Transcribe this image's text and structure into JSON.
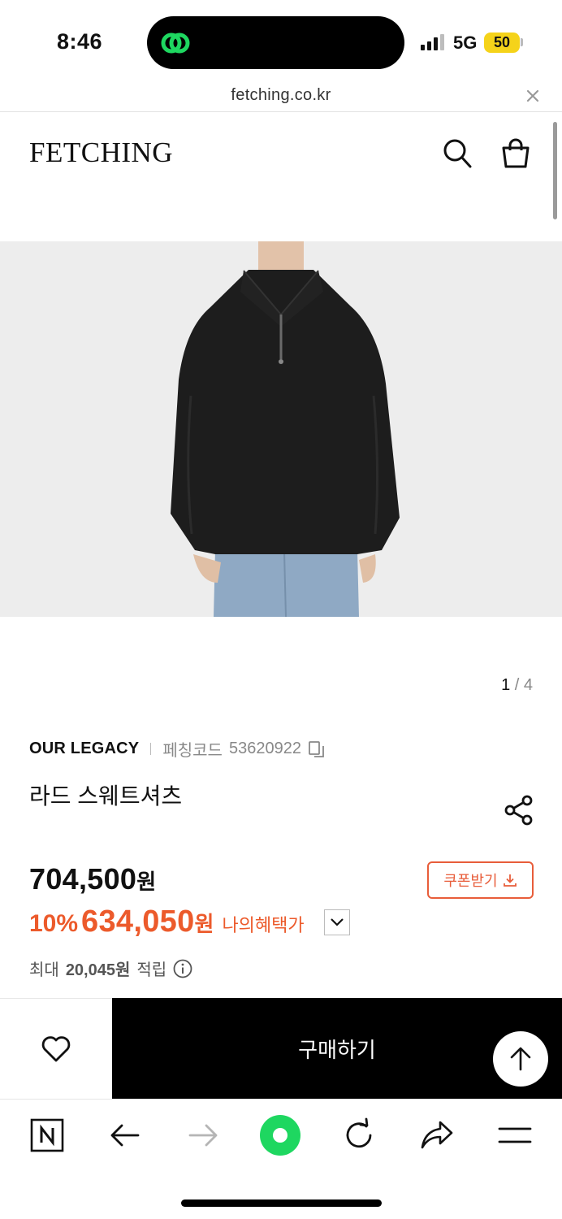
{
  "status_bar": {
    "time": "8:46",
    "network": "5G",
    "battery": "50"
  },
  "browser": {
    "url": "fetching.co.kr"
  },
  "header": {
    "logo": "FETCHING"
  },
  "gallery": {
    "current": "1",
    "separator": "/",
    "total": "4"
  },
  "product": {
    "brand": "OUR LEGACY",
    "code_label": "페칭코드",
    "code": "53620922",
    "name": "라드 스웨트셔츠",
    "original_price": "704,500",
    "currency": "원",
    "discount_rate": "10%",
    "sale_price": "634,050",
    "benefit_label": "나의혜택가",
    "points_prefix": "최대",
    "points_amount": "20,045원",
    "points_suffix": "적립"
  },
  "actions": {
    "coupon_label": "쿠폰받기",
    "buy_label": "구매하기"
  },
  "colors": {
    "sale": "#ec5a2b",
    "coupon": "#e85d3a",
    "buy_bg": "#000000",
    "assistant_green": "#1ed760"
  },
  "icons": [
    "search-icon",
    "shopping-bag-icon",
    "copy-icon",
    "share-icon",
    "download-icon",
    "chevron-down-icon",
    "info-icon",
    "heart-icon",
    "arrow-up-icon",
    "naver-icon",
    "back-icon",
    "forward-icon",
    "green-dot-icon",
    "reload-icon",
    "share-arrow-icon",
    "menu-icon"
  ]
}
